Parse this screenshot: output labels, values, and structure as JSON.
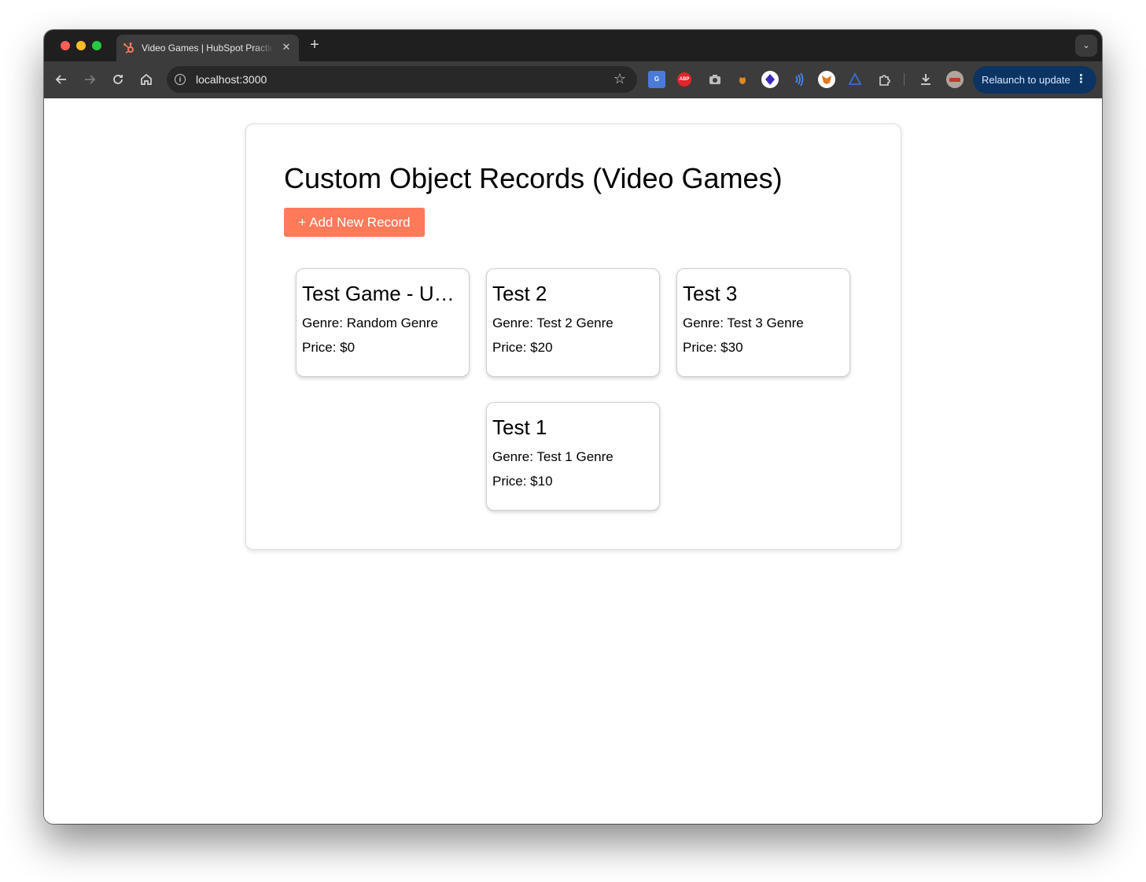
{
  "browser": {
    "tab": {
      "title": "Video Games | HubSpot Practice",
      "close_glyph": "✕"
    },
    "new_tab_glyph": "+",
    "tabs_menu_glyph": "⌄",
    "url": "localhost:3000",
    "relaunch_label": "Relaunch to update",
    "extensions": [
      "google-translate-icon",
      "adblock-plus-icon",
      "camera-icon",
      "bug-icon",
      "shield-extension-icon",
      "wave-extension-icon",
      "metamask-fox-icon",
      "triangle-extension-icon",
      "puzzle-extensions-icon",
      "download-icon",
      "profile-avatar"
    ],
    "extension_labels": {
      "abp": "ABP",
      "translate": "G"
    },
    "accent_color": "#ff7a59"
  },
  "page": {
    "title": "Custom Object Records (Video Games)",
    "add_button_label": "+ Add New Record",
    "records": [
      {
        "name": "Test Game - UI Test",
        "genre": "Genre: Random Genre",
        "price": "Price: $0"
      },
      {
        "name": "Test 2",
        "genre": "Genre: Test 2 Genre",
        "price": "Price: $20"
      },
      {
        "name": "Test 3",
        "genre": "Genre: Test 3 Genre",
        "price": "Price: $30"
      },
      {
        "name": "Test 1",
        "genre": "Genre: Test 1 Genre",
        "price": "Price: $10"
      }
    ]
  }
}
